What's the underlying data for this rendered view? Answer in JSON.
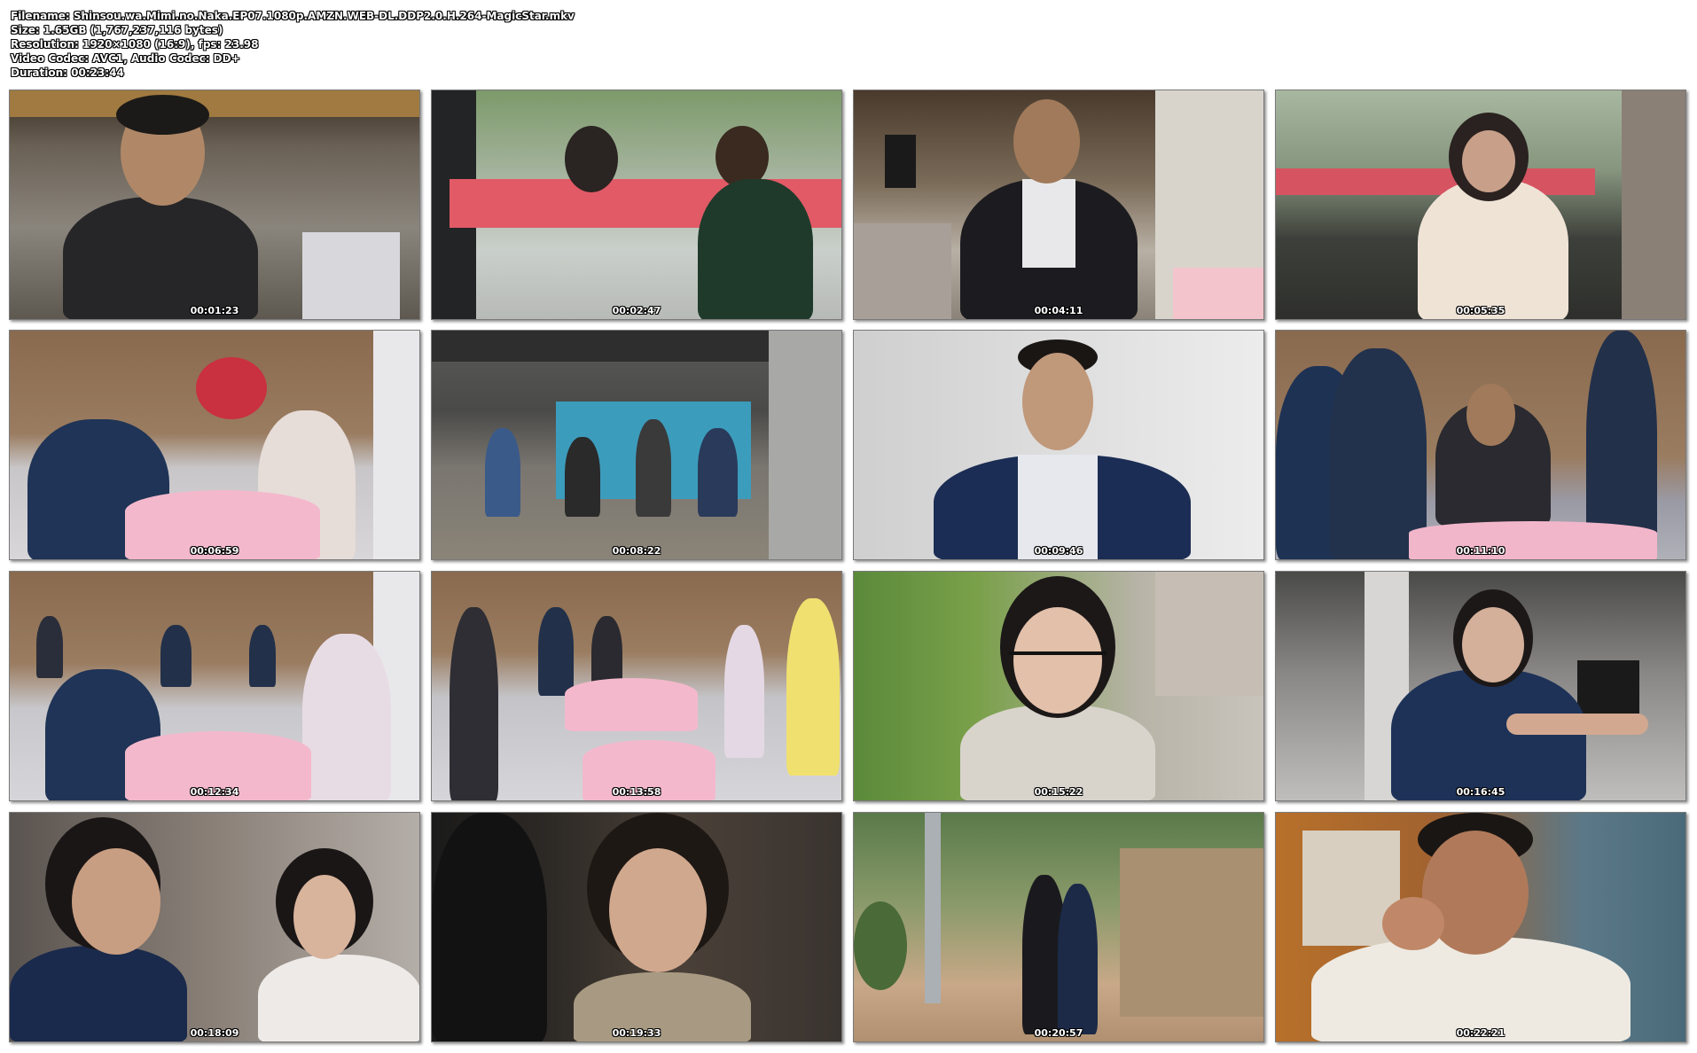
{
  "header": {
    "filename": "Filename: Shinsou.wa.Mimi.no.Naka.EP07.1080p.AMZN.WEB-DL.DDP2.0.H.264-MagicStar.mkv",
    "size": "Size: 1.65GB (1,767,237,116 bytes)",
    "resolution": "Resolution: 1920×1080 (16:9), fps: 23.98",
    "codecs": "Video Codec: AVC1, Audio Codec: DD+",
    "duration": "Duration: 00:23:44"
  },
  "thumbnails": [
    {
      "timestamp": "00:01:23"
    },
    {
      "timestamp": "00:02:47"
    },
    {
      "timestamp": "00:04:11"
    },
    {
      "timestamp": "00:05:35"
    },
    {
      "timestamp": "00:06:59"
    },
    {
      "timestamp": "00:08:22"
    },
    {
      "timestamp": "00:09:46"
    },
    {
      "timestamp": "00:11:10"
    },
    {
      "timestamp": "00:12:34"
    },
    {
      "timestamp": "00:13:58"
    },
    {
      "timestamp": "00:15:22"
    },
    {
      "timestamp": "00:16:45"
    },
    {
      "timestamp": "00:18:09"
    },
    {
      "timestamp": "00:19:33"
    },
    {
      "timestamp": "00:20:57"
    },
    {
      "timestamp": "00:22:21"
    }
  ]
}
